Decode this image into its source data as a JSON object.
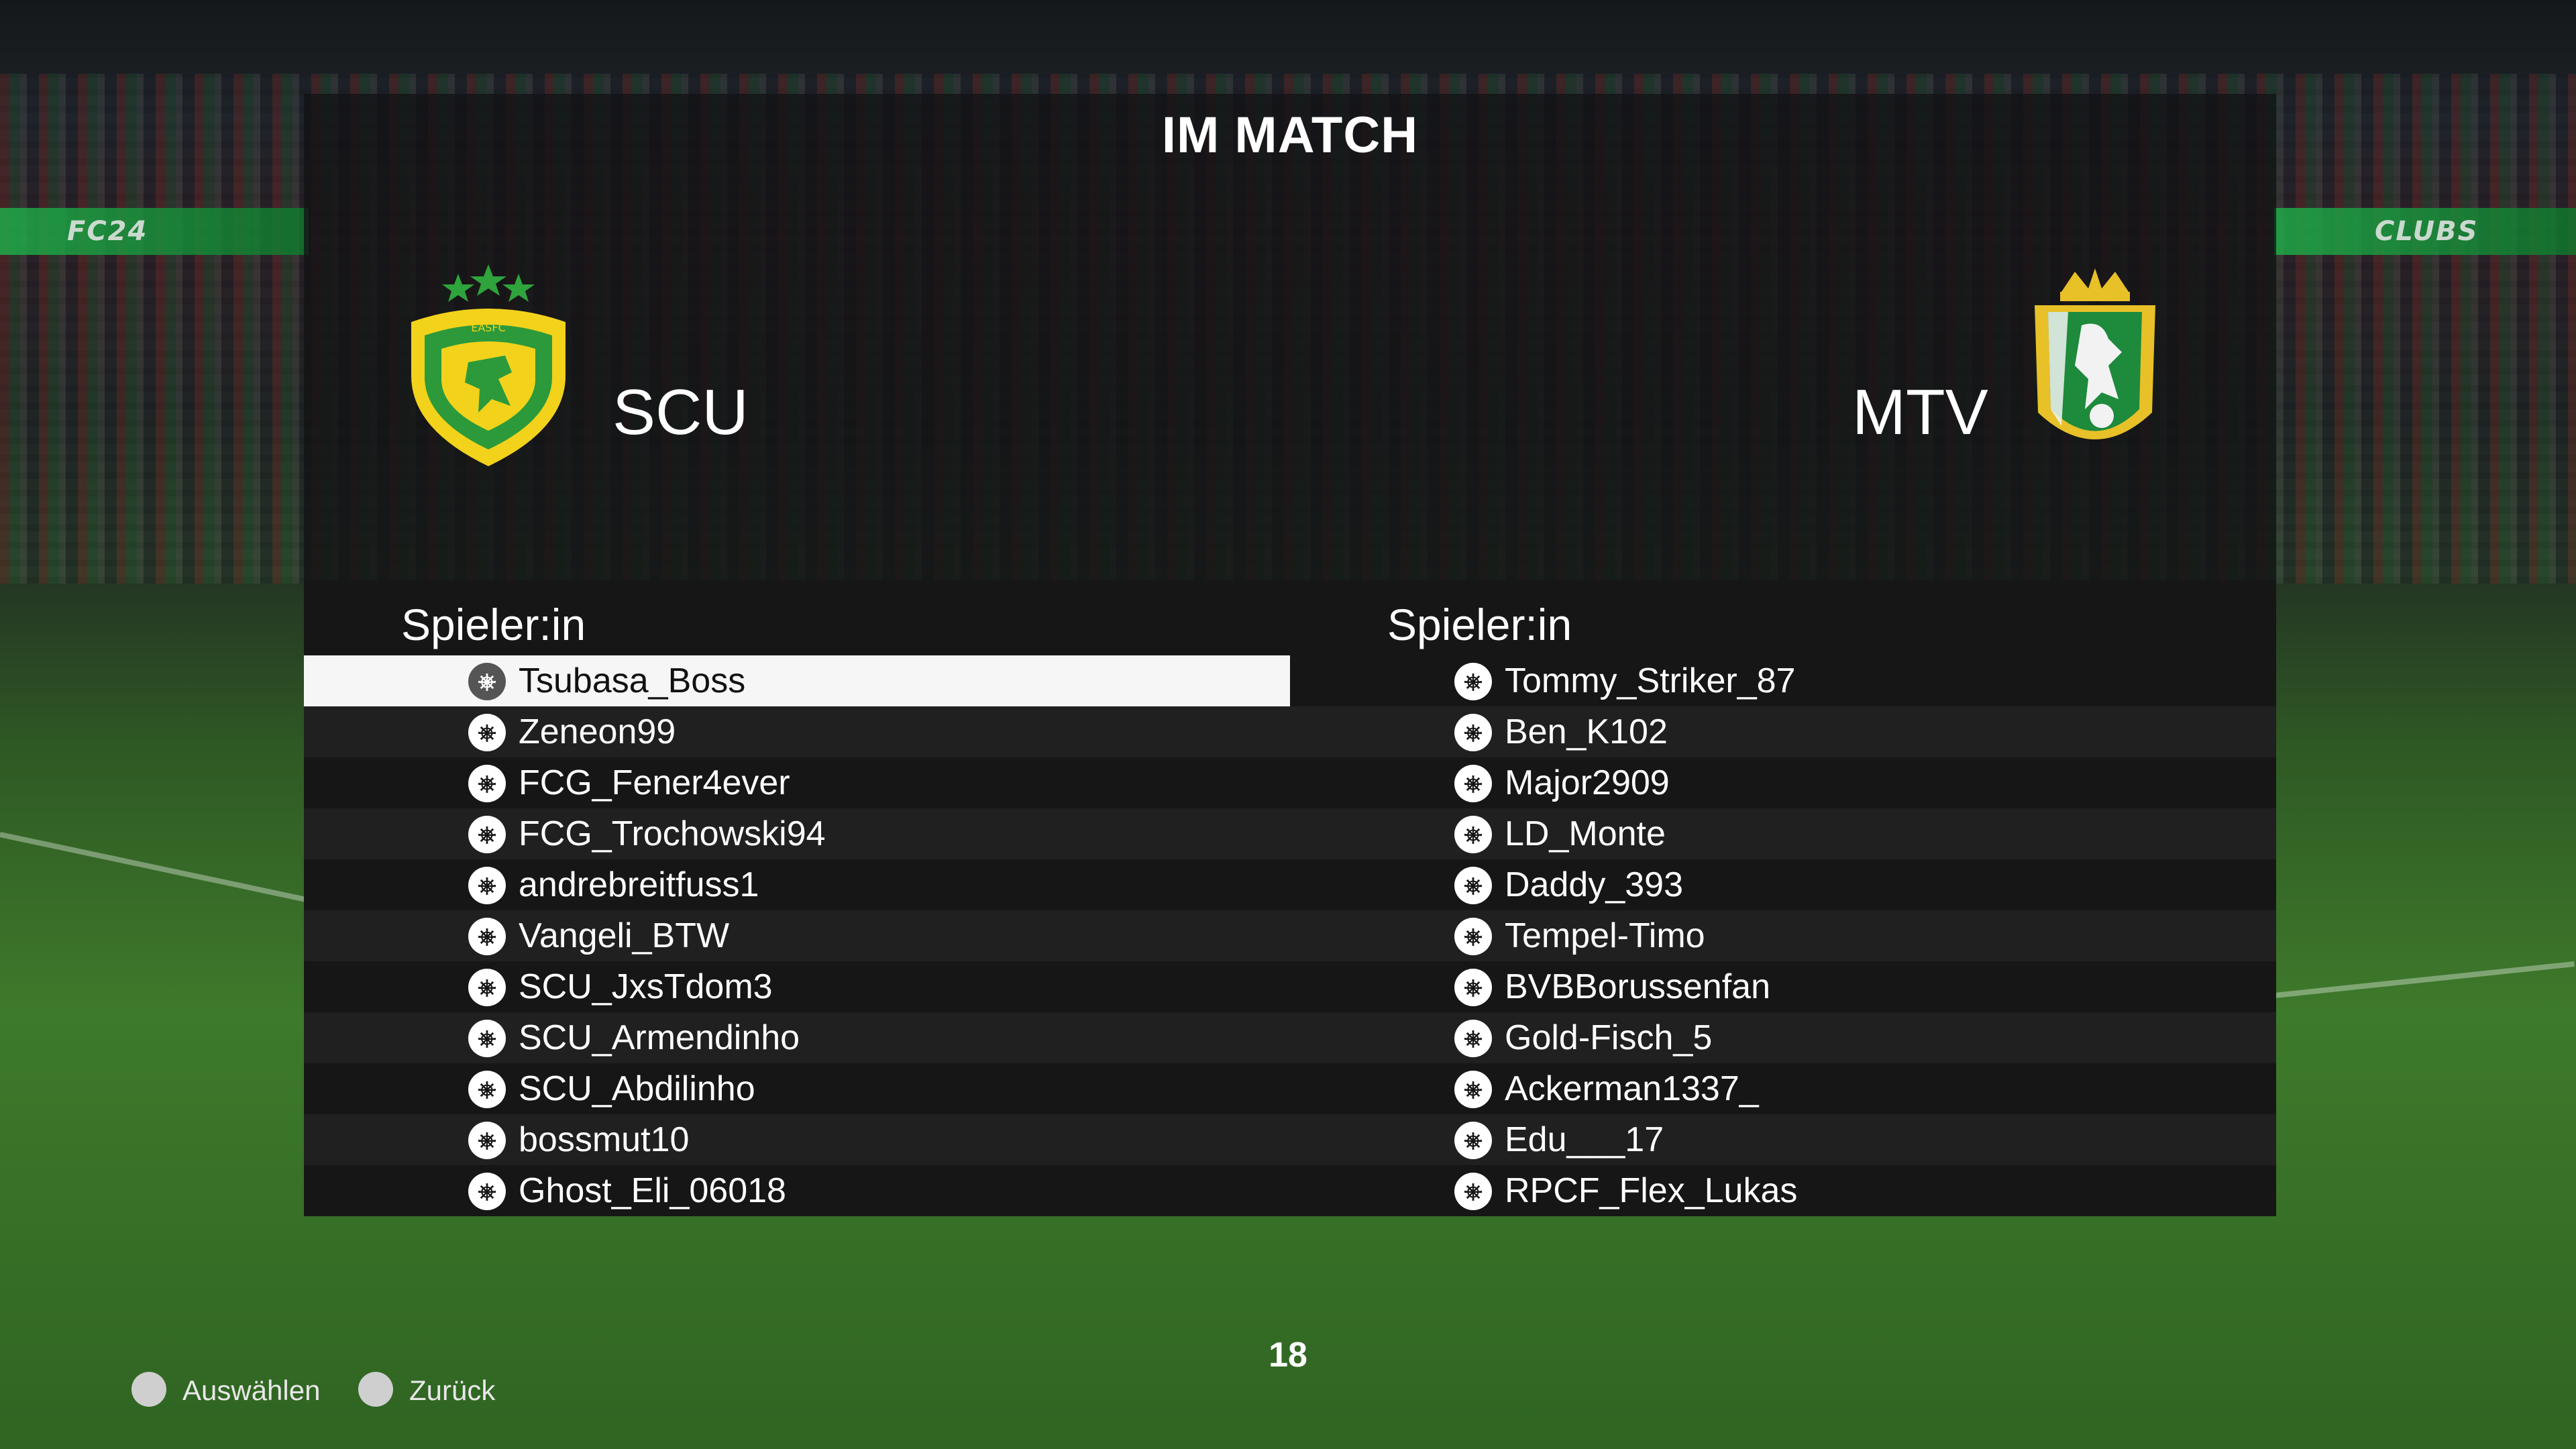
{
  "title": "IM MATCH",
  "home": {
    "name": "SCU",
    "crest_text": "EASFC",
    "column_header": "Spieler:in",
    "players": [
      "Tsubasa_Boss",
      "Zeneon99",
      "FCG_Fener4ever",
      "FCG_Trochowski94",
      "andrebreitfuss1",
      "Vangeli_BTW",
      "SCU_JxsTdom3",
      "SCU_Armendinho",
      "SCU_Abdilinho",
      "bossmut10",
      "Ghost_Eli_06018"
    ],
    "selected_index": 0
  },
  "away": {
    "name": "MTV",
    "column_header": "Spieler:in",
    "players": [
      "Tommy_Striker_87",
      "Ben_K102",
      "Major2909",
      "LD_Monte",
      "Daddy_393",
      "Tempel-Timo",
      "BVBBorussenfan",
      "Gold-Fisch_5",
      "Ackerman1337_",
      "Edu___17",
      "RPCF_Flex_Lukas"
    ]
  },
  "background_ads": [
    "FC24",
    "CLUBS",
    "CLUBS"
  ],
  "platform_icon": "playstation-icon",
  "footer": {
    "select_label": "Auswählen",
    "back_label": "Zurück",
    "page_number": "18"
  },
  "colors": {
    "panel_bg": "#161616",
    "row_alt_bg": "#202020",
    "selected_bg": "#f6f6f6",
    "home_crest_yellow": "#f2d21b",
    "home_crest_green": "#2c9a3a",
    "away_crest_green": "#1d8a3c",
    "away_crest_gold": "#e8c028"
  }
}
